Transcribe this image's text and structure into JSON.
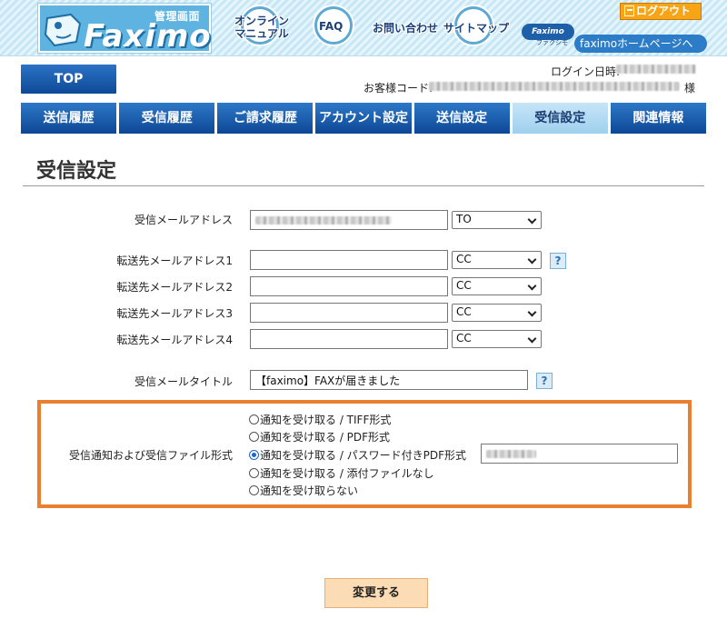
{
  "header": {
    "logo_admin_label": "管理画面",
    "logo_word": "Faximo",
    "links": {
      "online_manual_line1": "オンライン",
      "online_manual_line2": "マニュアル",
      "faq": "FAQ",
      "contact": "お問い合わせ",
      "sitemap": "サイトマップ",
      "faximo_badge": "Faximo",
      "faximo_kana": "ファクシモ",
      "faximo_home": "faximoホームページへ"
    },
    "logout_label": "ログアウト"
  },
  "topbar": {
    "top_button": "TOP",
    "login_label": "ログイン日時:",
    "customer_label": "お客様コード:",
    "customer_suffix": "様"
  },
  "tabs": [
    {
      "label": "送信履歴",
      "active": false
    },
    {
      "label": "受信履歴",
      "active": false
    },
    {
      "label": "ご請求履歴",
      "active": false
    },
    {
      "label": "アカウント設定",
      "active": false
    },
    {
      "label": "送信設定",
      "active": false
    },
    {
      "label": "受信設定",
      "active": true
    },
    {
      "label": "関連情報",
      "active": false
    }
  ],
  "page_title": "受信設定",
  "form": {
    "receive_email_label": "受信メールアドレス",
    "receive_email_type": "TO",
    "forward": [
      {
        "label": "転送先メールアドレス1",
        "type": "CC"
      },
      {
        "label": "転送先メールアドレス2",
        "type": "CC"
      },
      {
        "label": "転送先メールアドレス3",
        "type": "CC"
      },
      {
        "label": "転送先メールアドレス4",
        "type": "CC"
      }
    ],
    "mail_title_label": "受信メールタイトル",
    "mail_title_value": "【faximo】FAXが届きました",
    "notify_label": "受信通知および受信ファイル形式",
    "notify_options": [
      {
        "label": "通知を受け取る / TIFF形式",
        "checked": false
      },
      {
        "label": "通知を受け取る / PDF形式",
        "checked": false
      },
      {
        "label": "通知を受け取る / パスワード付きPDF形式",
        "checked": true
      },
      {
        "label": "通知を受け取る / 添付ファイルなし",
        "checked": false
      },
      {
        "label": "通知を受け取らない",
        "checked": false
      }
    ],
    "help_glyph": "?",
    "submit_label": "変更する"
  },
  "colors": {
    "tab_blue": "#0d4795",
    "tab_active": "#9fd0ee",
    "highlight_border": "#ea7f2e",
    "logout_orange": "#f7a417",
    "submit_bg": "#fcdcb4"
  }
}
